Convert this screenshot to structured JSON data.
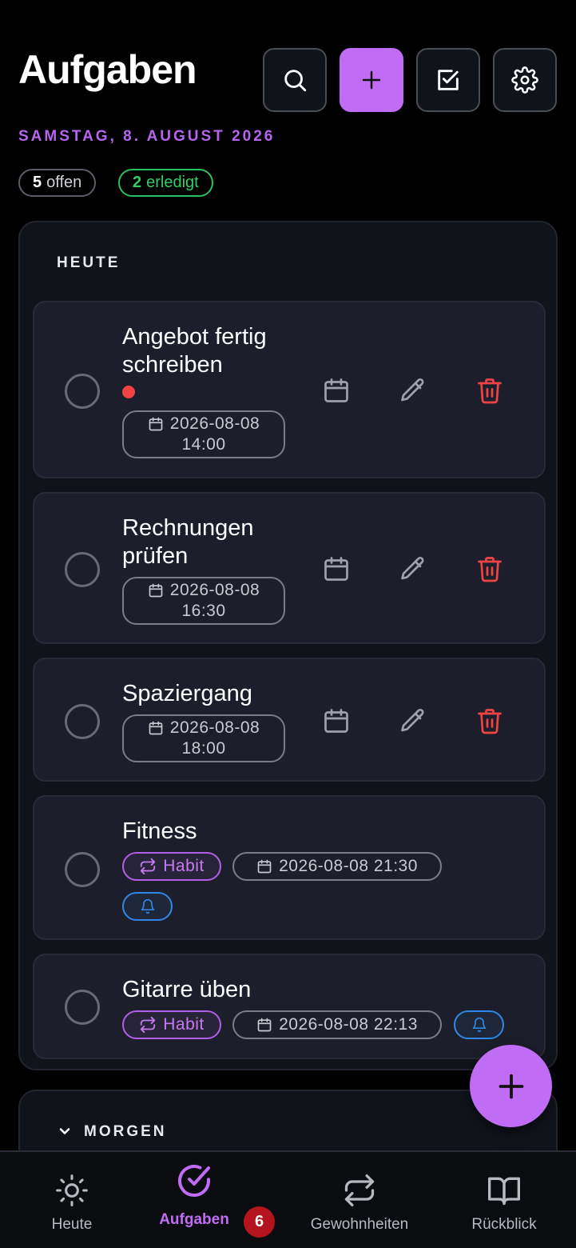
{
  "header": {
    "title": "Aufgaben",
    "date": "SAMSTAG, 8. AUGUST 2026",
    "open_count": "5",
    "open_label": "offen",
    "done_count": "2",
    "done_label": "erledigt"
  },
  "today": {
    "title": "HEUTE",
    "tasks": [
      {
        "title_l1": "Angebot fertig",
        "title_l2": "schreiben",
        "date": "2026-08-08",
        "time": "14:00"
      },
      {
        "title_l1": "Rechnungen",
        "title_l2": "prüfen",
        "date": "2026-08-08",
        "time": "16:30"
      },
      {
        "title": "Spaziergang",
        "date": "2026-08-08",
        "time": "18:00"
      },
      {
        "title": "Fitness",
        "habit": "Habit",
        "datetime": "2026-08-08 21:30"
      },
      {
        "title": "Gitarre üben",
        "habit": "Habit",
        "datetime": "2026-08-08 22:13"
      }
    ]
  },
  "tomorrow": {
    "title": "MORGEN"
  },
  "nav": {
    "items": [
      {
        "label": "Heute"
      },
      {
        "label": "Aufgaben",
        "badge": "6"
      },
      {
        "label": "Gewohnheiten"
      },
      {
        "label": "Rückblick"
      }
    ]
  },
  "colors": {
    "accent": "#c06cf5",
    "danger": "#f04444",
    "success": "#31cf66",
    "info": "#2f86e6"
  },
  "icons": [
    "search-icon",
    "plus-icon",
    "checkbox-icon",
    "gear-icon",
    "calendar-icon",
    "pencil-icon",
    "trash-icon",
    "repeat-icon",
    "bell-icon",
    "sun-icon",
    "check-circle-icon",
    "book-icon",
    "chevron-down-icon"
  ]
}
